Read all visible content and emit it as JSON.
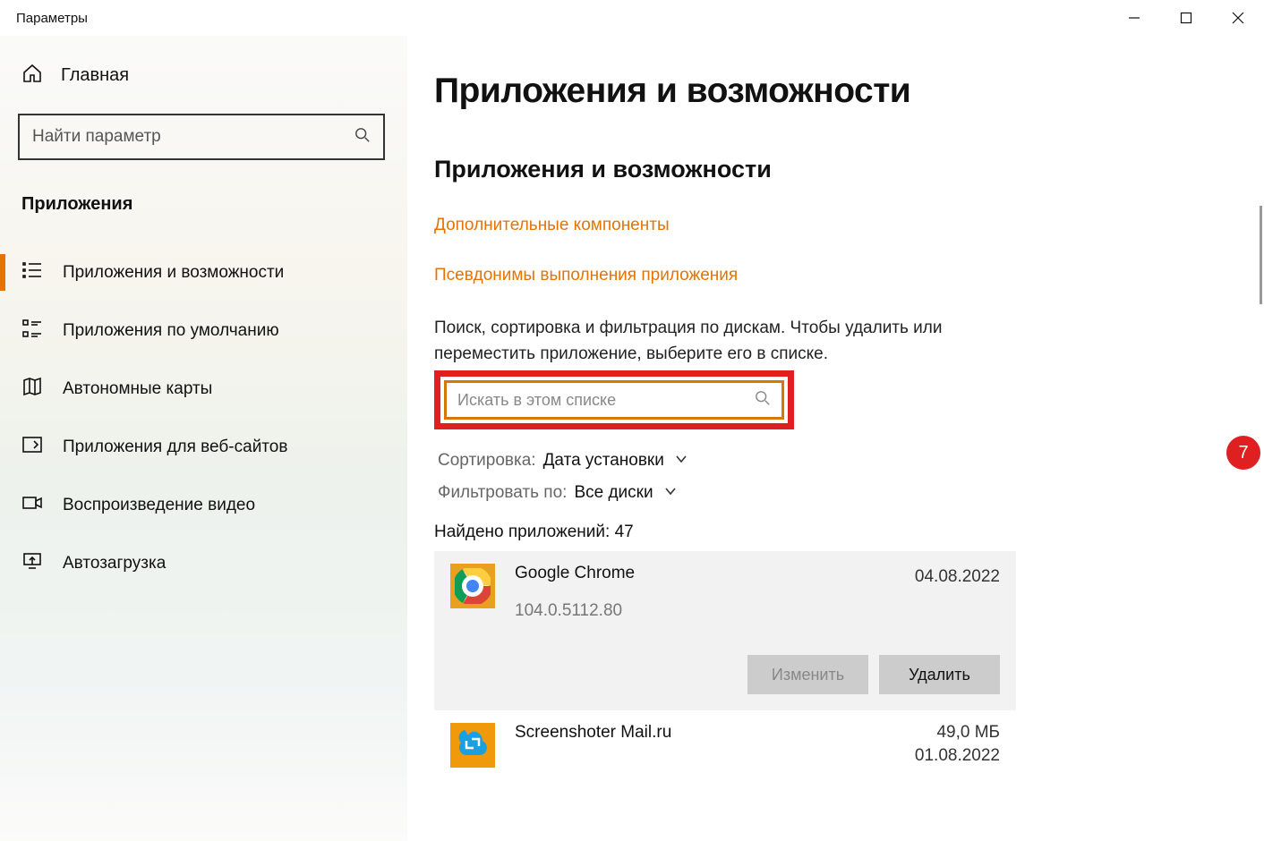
{
  "window": {
    "title": "Параметры"
  },
  "sidebar": {
    "home": "Главная",
    "search_placeholder": "Найти параметр",
    "section": "Приложения",
    "items": [
      {
        "label": "Приложения и возможности",
        "active": true
      },
      {
        "label": "Приложения по умолчанию"
      },
      {
        "label": "Автономные карты"
      },
      {
        "label": "Приложения для веб-сайтов"
      },
      {
        "label": "Воспроизведение видео"
      },
      {
        "label": "Автозагрузка"
      }
    ]
  },
  "main": {
    "title": "Приложения и возможности",
    "subtitle": "Приложения и возможности",
    "links": {
      "optional": "Дополнительные компоненты",
      "aliases": "Псевдонимы выполнения приложения"
    },
    "info_text": "Поиск, сортировка и фильтрация по дискам. Чтобы удалить или переместить приложение, выберите его в списке.",
    "list_search_placeholder": "Искать в этом списке",
    "badge_number": "7",
    "sort": {
      "label": "Сортировка:",
      "value": "Дата установки"
    },
    "filter": {
      "label": "Фильтровать по:",
      "value": "Все диски"
    },
    "count_text": "Найдено приложений: 47",
    "apps": [
      {
        "name": "Google Chrome",
        "version": "104.0.5112.80",
        "size": "",
        "date": "04.08.2022"
      },
      {
        "name": "Screenshoter Mail.ru",
        "version": "",
        "size": "49,0 МБ",
        "date": "01.08.2022"
      }
    ],
    "buttons": {
      "modify": "Изменить",
      "uninstall": "Удалить"
    }
  }
}
